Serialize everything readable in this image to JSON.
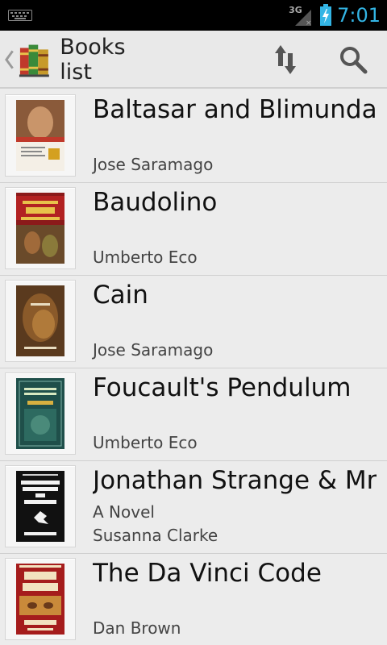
{
  "status_bar": {
    "network": "3G",
    "time": "7:01",
    "icons": [
      "keyboard-icon",
      "signal-3g-icon",
      "battery-charging-icon"
    ],
    "time_color": "#33b5e5"
  },
  "action_bar": {
    "title": "Books list",
    "icons": [
      "up-chevron-icon",
      "app-books-logo-icon",
      "sort-icon",
      "search-icon"
    ]
  },
  "books": [
    {
      "title": "Baltasar and Blimunda",
      "subtitle": "",
      "author": "Jose Saramago"
    },
    {
      "title": "Baudolino",
      "subtitle": "",
      "author": "Umberto Eco"
    },
    {
      "title": "Cain",
      "subtitle": "",
      "author": "Jose Saramago"
    },
    {
      "title": "Foucault's Pendulum",
      "subtitle": "",
      "author": "Umberto Eco"
    },
    {
      "title": "Jonathan Strange & Mr",
      "subtitle": "A Novel",
      "author": "Susanna Clarke"
    },
    {
      "title": "The Da Vinci Code",
      "subtitle": "",
      "author": "Dan Brown"
    }
  ]
}
